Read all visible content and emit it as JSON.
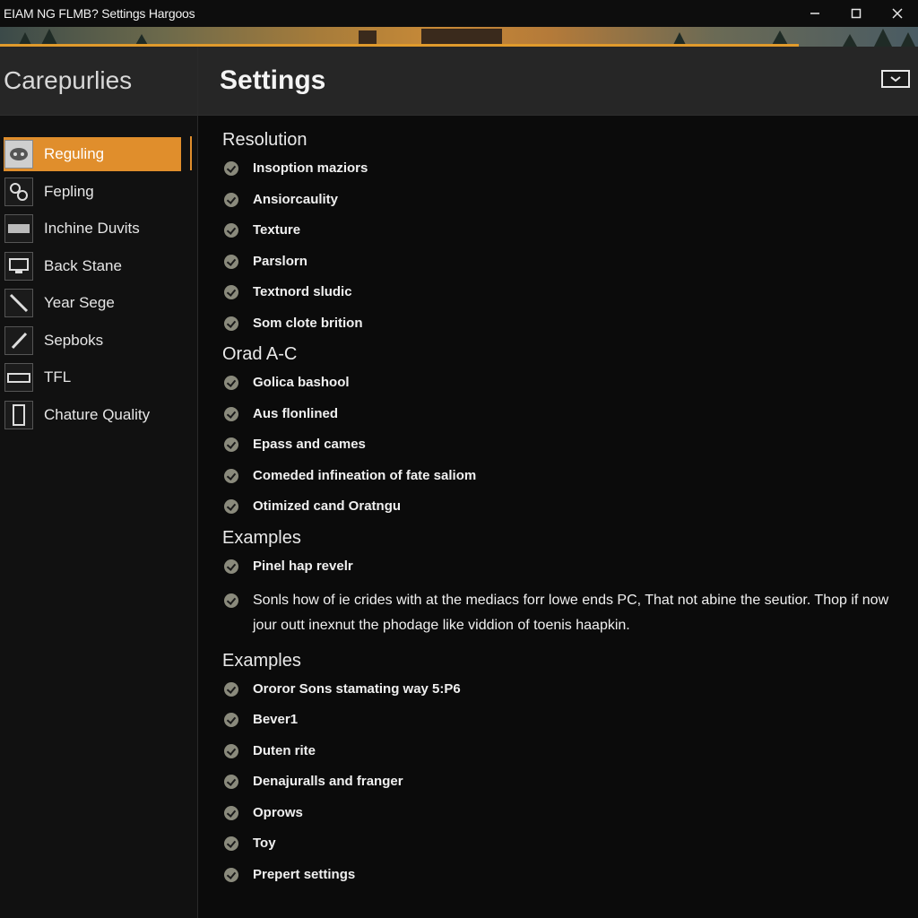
{
  "window": {
    "title": "EIAM NG FLMB? Settings Hargoos",
    "controls": {
      "minimize": "minimize-icon",
      "maximize": "maximize-icon",
      "close": "close-icon"
    }
  },
  "banner": {
    "progress_fraction": 0.87,
    "accent_color": "#e09a2c"
  },
  "sidebar": {
    "header": "Carepurlies",
    "items": [
      {
        "label": "Reguling",
        "icon": "controller-icon",
        "active": true
      },
      {
        "label": "Fepling",
        "icon": "gear-cluster-icon",
        "active": false
      },
      {
        "label": "Inchine Duvits",
        "icon": "drive-icon",
        "active": false
      },
      {
        "label": "Back Stane",
        "icon": "monitor-icon",
        "active": false
      },
      {
        "label": "Year Sege",
        "icon": "slash-icon",
        "active": false
      },
      {
        "label": "Sepboks",
        "icon": "pen-icon",
        "active": false
      },
      {
        "label": "TFL",
        "icon": "keyboard-icon",
        "active": false
      },
      {
        "label": "Chature Quality",
        "icon": "phone-icon",
        "active": false
      }
    ],
    "active_color": "#e08e2c"
  },
  "main": {
    "title": "Settings",
    "header_button_icon": "chevron-down-box-icon",
    "sections": [
      {
        "title": "Resolution",
        "options": [
          "Insoption maziors",
          "Ansiorcaulity",
          "Texture",
          "Parslorn",
          "Textnord sludic",
          "Som clote brition"
        ]
      },
      {
        "title": "Orad A-C",
        "options": [
          "Golica bashool",
          "Aus flonlined",
          "Epass and cames",
          "Comeded infineation of fate saliom",
          "Otimized cand Oratngu"
        ]
      },
      {
        "title": "Examples",
        "options": [
          "Pinel hap revelr",
          "Sonls how of ie crides with at the mediacs forr lowe ends PC, That not abine the seutior. Thop if now jour outt inexnut the phodage like viddion of toenis haapkin."
        ]
      },
      {
        "title": "Examples",
        "options": [
          "Ororor Sons stamating way 5:P6",
          "Bever1",
          "Duten rite",
          "Denajuralls and franger",
          "Oprows",
          "Toy",
          "Prepert settings"
        ]
      }
    ]
  }
}
